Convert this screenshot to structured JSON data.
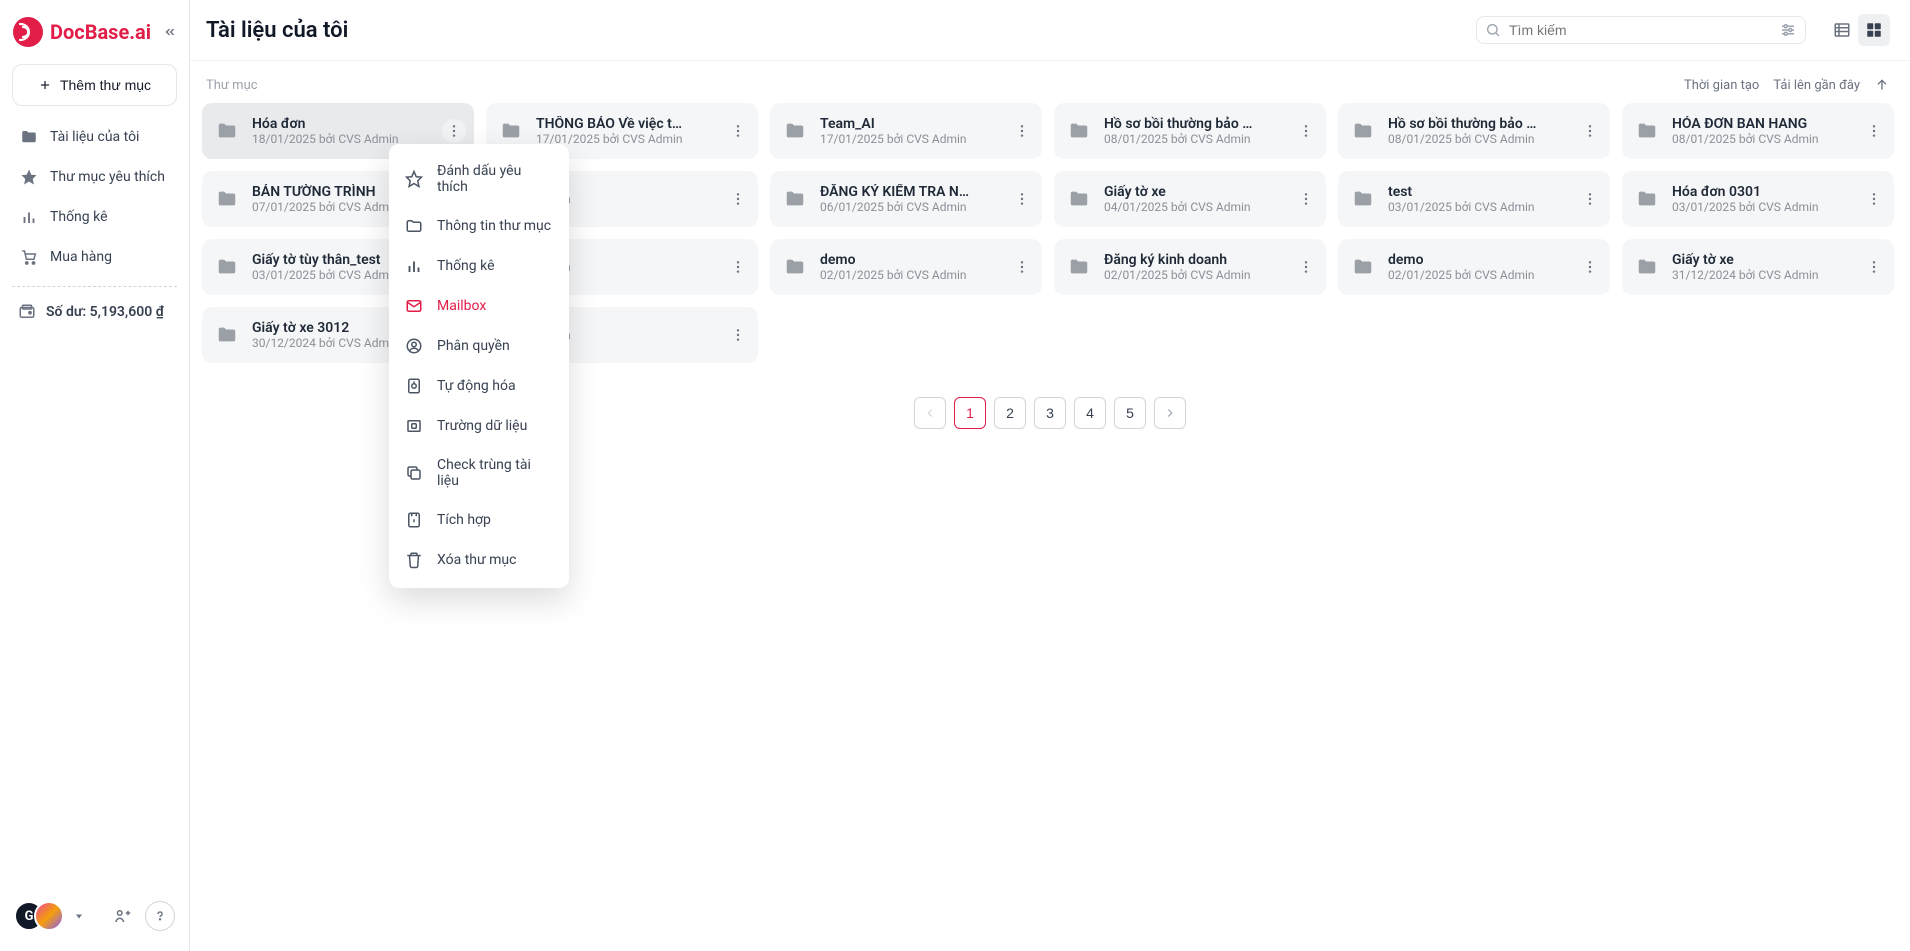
{
  "brand": {
    "name": "DocBase.ai"
  },
  "sidebar": {
    "add_folder_label": "Thêm thư mục",
    "nav": [
      {
        "label": "Tài liệu của tôi",
        "icon": "folder-icon"
      },
      {
        "label": "Thư mục yêu thích",
        "icon": "star-icon"
      },
      {
        "label": "Thống kê",
        "icon": "stats-icon"
      },
      {
        "label": "Mua hàng",
        "icon": "cart-icon"
      }
    ],
    "balance_label": "Số dư: 5,193,600 ₫",
    "avatar_letter": "G"
  },
  "header": {
    "title": "Tài liệu của tôi",
    "search_placeholder": "Tìm kiếm"
  },
  "list_header": {
    "section_label": "Thư mục",
    "sort_time_label": "Thời gian tạo",
    "sort_recent_label": "Tải lên gần đây"
  },
  "folders": [
    {
      "title": "Hóa đơn",
      "meta": "18/01/2025 bởi CVS Admin",
      "active": true
    },
    {
      "title": "THÔNG BÁO Về việc t…",
      "meta": "17/01/2025 bởi CVS Admin"
    },
    {
      "title": "Team_AI",
      "meta": "17/01/2025 bởi CVS Admin"
    },
    {
      "title": "Hồ sơ bồi thường bảo …",
      "meta": "08/01/2025 bởi CVS Admin"
    },
    {
      "title": "Hồ sơ bồi thường bảo …",
      "meta": "08/01/2025 bởi CVS Admin"
    },
    {
      "title": "HÓA ĐƠN BAN HANG",
      "meta": "08/01/2025 bởi CVS Admin"
    },
    {
      "title": "BẢN TƯỜNG TRÌNH",
      "meta": "07/01/2025 bởi CVS Admin"
    },
    {
      "title": "",
      "meta": "Admin"
    },
    {
      "title": "ĐĂNG KÝ KIỂM TRA N…",
      "meta": "06/01/2025 bởi CVS Admin"
    },
    {
      "title": "Giấy tờ xe",
      "meta": "04/01/2025 bởi CVS Admin"
    },
    {
      "title": "test",
      "meta": "03/01/2025 bởi CVS Admin"
    },
    {
      "title": "Hóa đơn 0301",
      "meta": "03/01/2025 bởi CVS Admin"
    },
    {
      "title": "Giấy tờ tùy thân_test",
      "meta": "03/01/2025 bởi CVS Admin"
    },
    {
      "title": "",
      "meta": "Admin"
    },
    {
      "title": "demo",
      "meta": "02/01/2025 bởi CVS Admin"
    },
    {
      "title": "Đăng ký kinh doanh",
      "meta": "02/01/2025 bởi CVS Admin"
    },
    {
      "title": "demo",
      "meta": "02/01/2025 bởi CVS Admin"
    },
    {
      "title": "Giấy tờ xe",
      "meta": "31/12/2024 bởi CVS Admin"
    },
    {
      "title": "Giấy tờ xe 3012",
      "meta": "30/12/2024 bởi CVS Admin"
    },
    {
      "title": "",
      "meta": "Admin"
    }
  ],
  "context_menu": [
    {
      "label": "Đánh dấu yêu thích",
      "icon": "star-outline-icon"
    },
    {
      "label": "Thông tin thư mục",
      "icon": "folder-outline-icon"
    },
    {
      "label": "Thống kê",
      "icon": "stats-icon"
    },
    {
      "label": "Mailbox",
      "icon": "mail-icon",
      "red": true
    },
    {
      "label": "Phân quyền",
      "icon": "user-cog-icon"
    },
    {
      "label": "Tự động hóa",
      "icon": "automation-icon"
    },
    {
      "label": "Trường dữ liệu",
      "icon": "fields-icon"
    },
    {
      "label": "Check trùng tài liệu",
      "icon": "copy-icon"
    },
    {
      "label": "Tích hợp",
      "icon": "integration-icon"
    },
    {
      "label": "Xóa thư mục",
      "icon": "trash-icon"
    }
  ],
  "pagination": {
    "pages": [
      "1",
      "2",
      "3",
      "4",
      "5"
    ],
    "active": "1"
  }
}
